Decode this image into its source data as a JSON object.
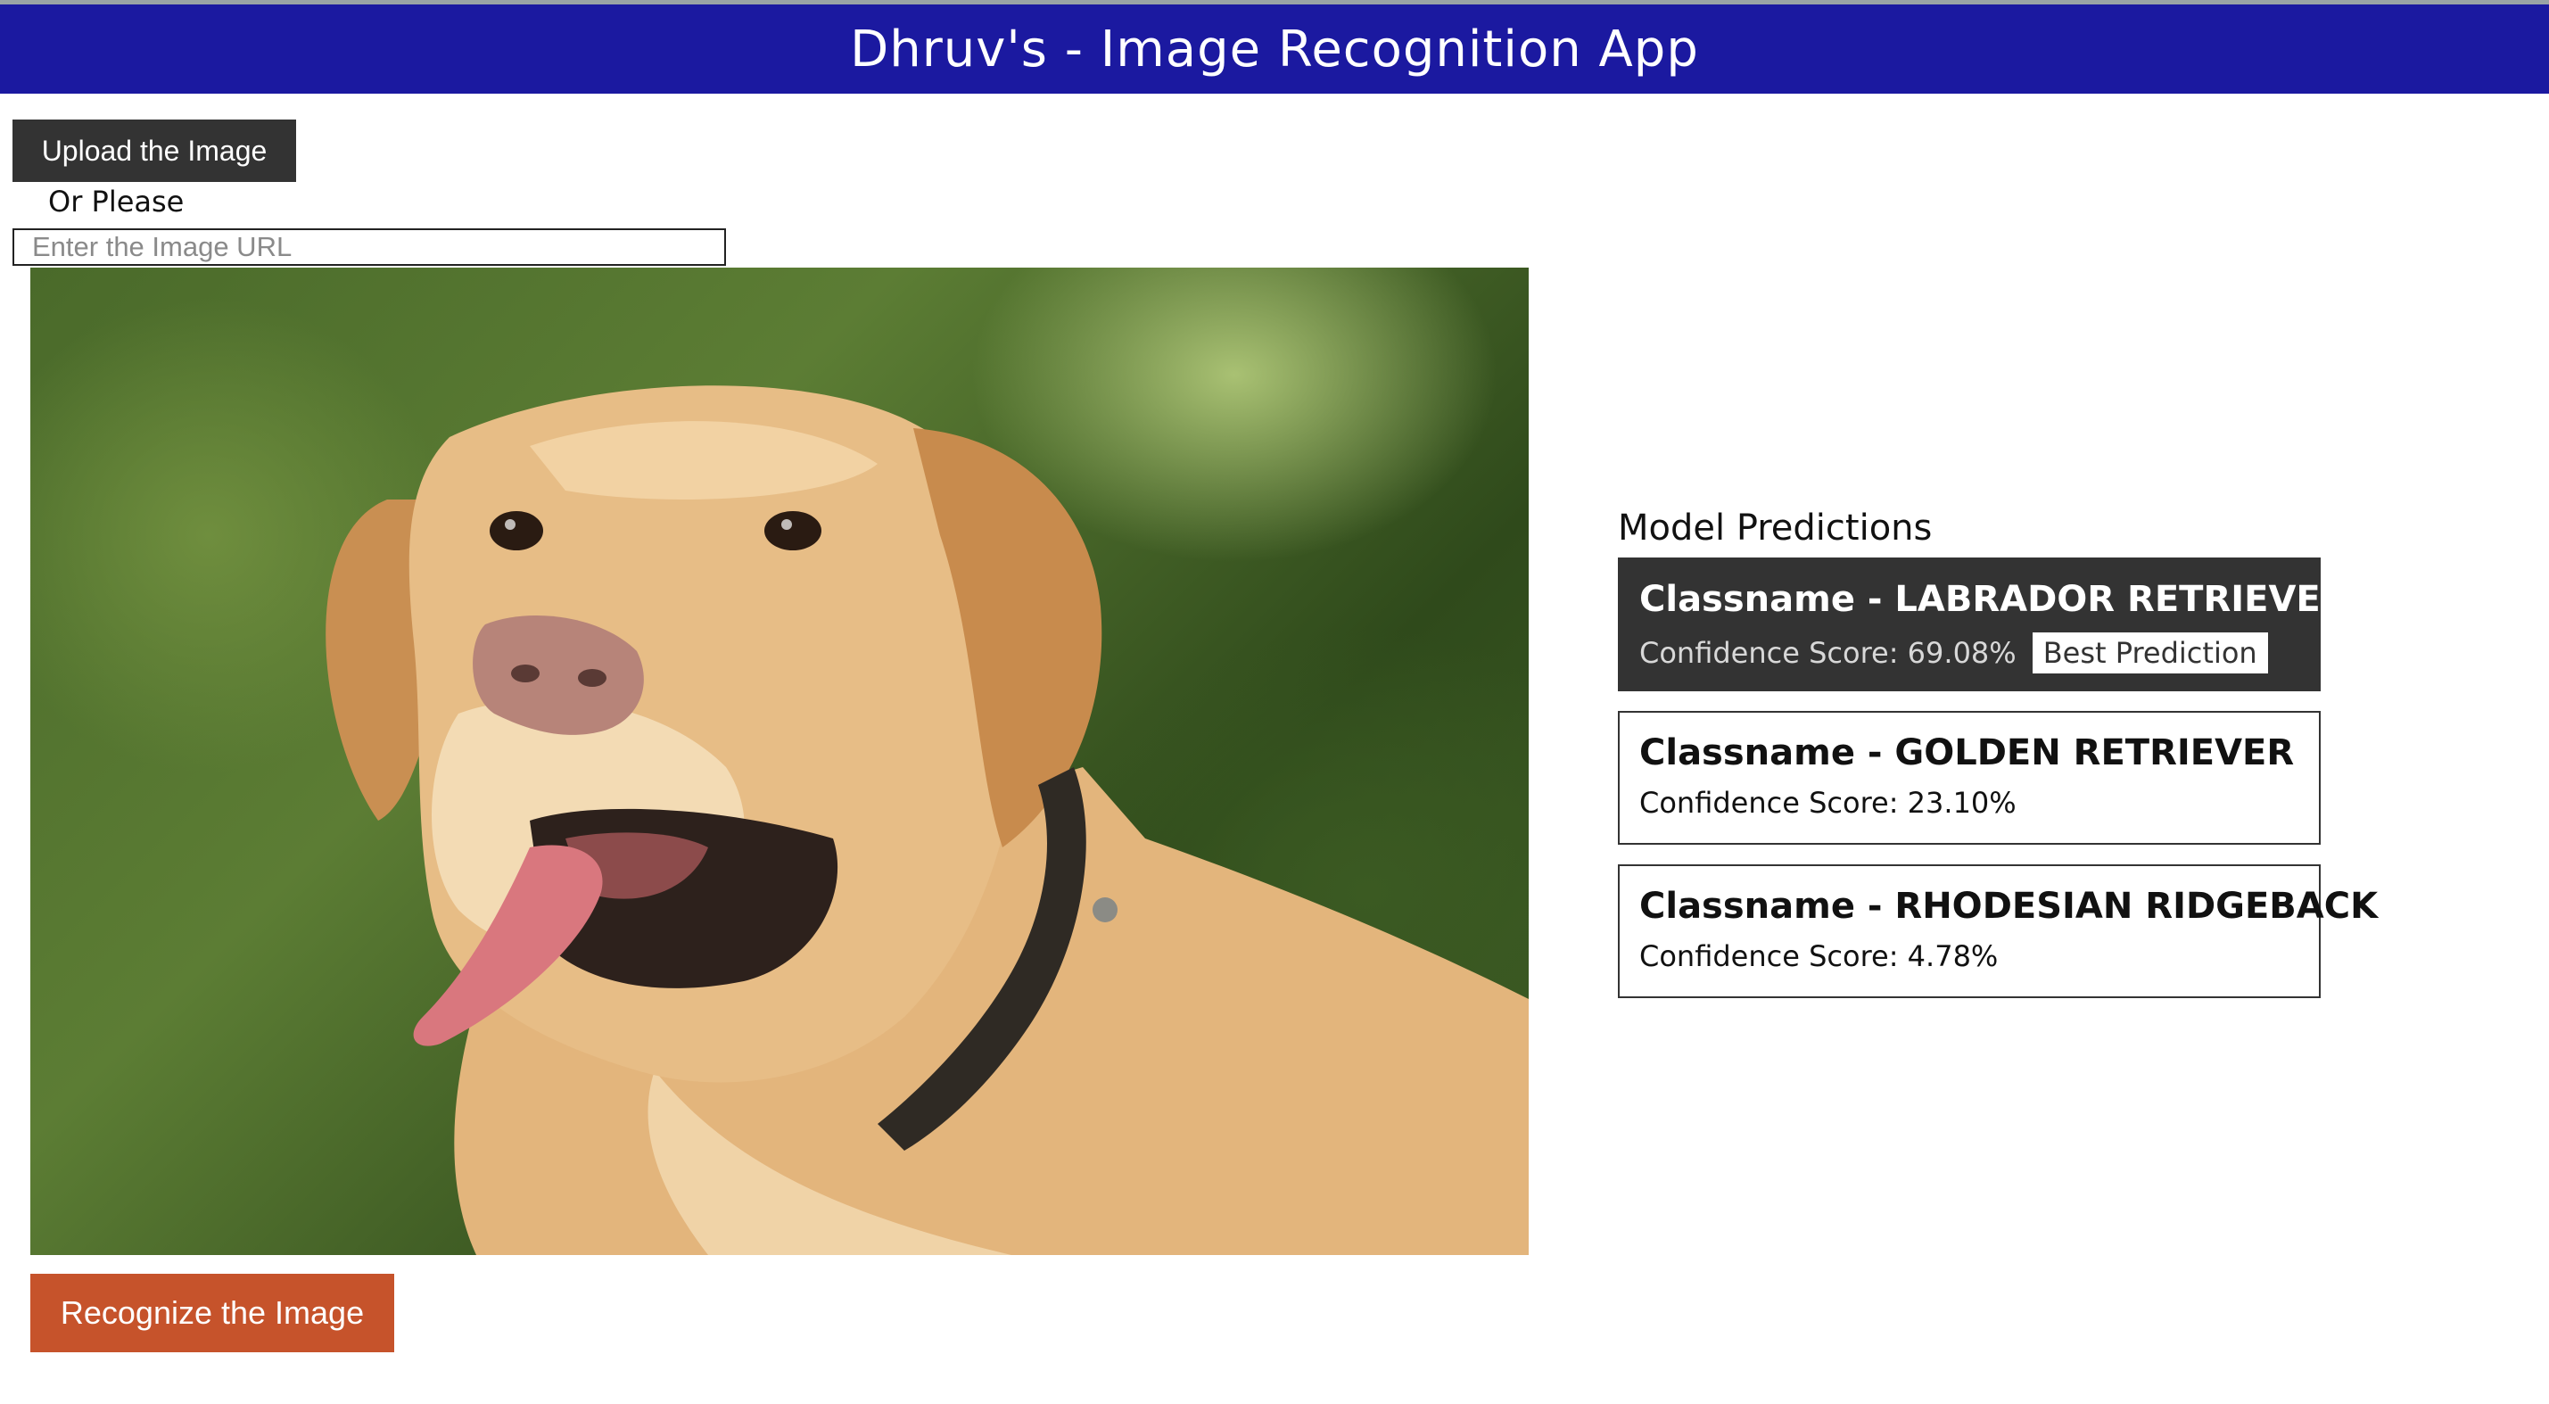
{
  "header": {
    "title": "Dhruv's - Image Recognition App"
  },
  "upload": {
    "button_label": "Upload the Image",
    "or_text": "Or Please",
    "url_placeholder": "Enter the Image URL",
    "url_value": ""
  },
  "image": {
    "subject": "dog-photo"
  },
  "actions": {
    "recognize_label": "Recognize the Image"
  },
  "predictions": {
    "title": "Model Predictions",
    "best_badge": "Best Prediction",
    "items": [
      {
        "name": "Classname - LABRADOR RETRIEVER",
        "score": "Confidence Score: 69.08%",
        "best": true
      },
      {
        "name": "Classname - GOLDEN RETRIEVER",
        "score": "Confidence Score: 23.10%",
        "best": false
      },
      {
        "name": "Classname - RHODESIAN RIDGEBACK",
        "score": "Confidence Score: 4.78%",
        "best": false
      }
    ]
  },
  "colors": {
    "header_bg": "#1b19a0",
    "upload_btn_bg": "#333333",
    "recognize_btn_bg": "#c6532b",
    "best_card_bg": "#333333"
  }
}
